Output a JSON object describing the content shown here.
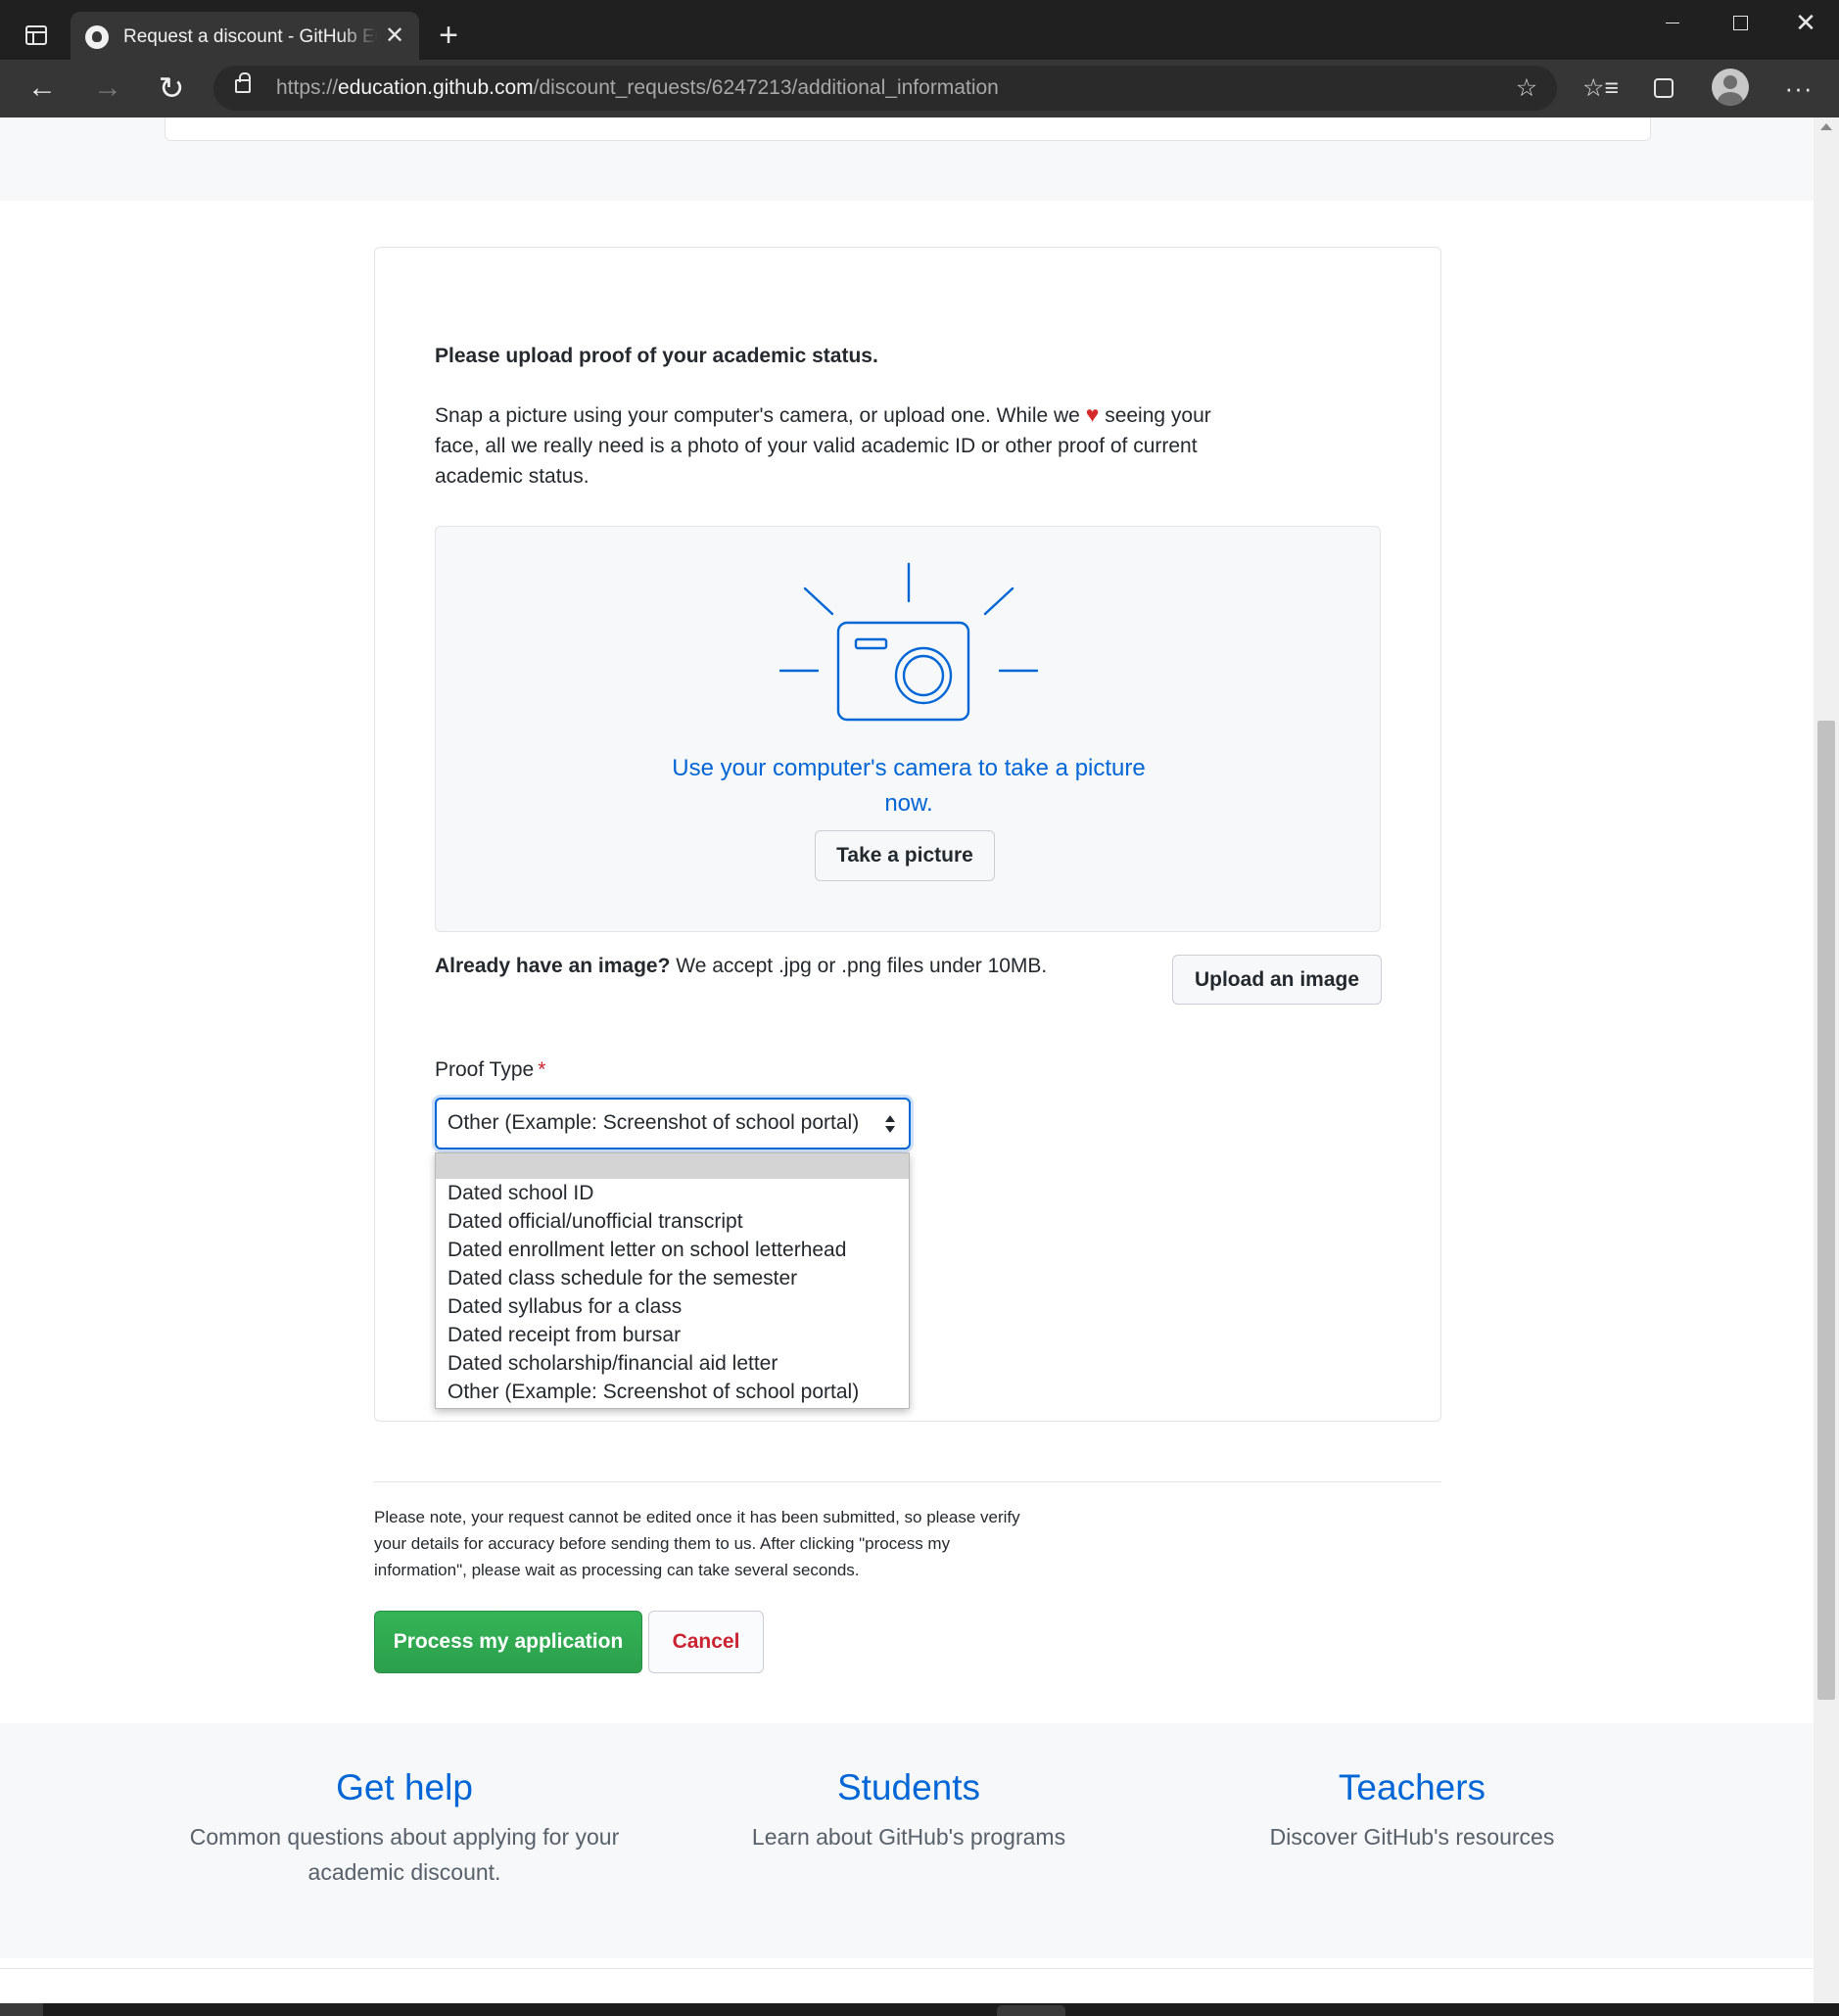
{
  "browser": {
    "tab_title": "Request a discount - GitHub Education",
    "tab_close": "✕",
    "new_tab": "+",
    "url_scheme": "https://",
    "url_host": "education.github.com",
    "url_path": "/discount_requests/6247213/additional_information",
    "window_close": "✕"
  },
  "upload": {
    "heading": "Please upload proof of your academic status.",
    "intro_before_heart": "Snap a picture using your computer's camera, or upload one. While we",
    "heart": "♥",
    "intro_after_heart": "seeing your face, all we really need is a photo of your valid academic ID or other proof of current academic status.",
    "camera_text": "Use your computer's camera to take a picture now.",
    "take_picture_label": "Take a picture",
    "already_bold": "Already have an image?",
    "already_text": "We accept .jpg or .png files under 10MB.",
    "upload_label": "Upload an image"
  },
  "proof_type": {
    "label": "Proof Type",
    "required_mark": "*",
    "selected": "Other (Example: Screenshot of school portal)",
    "options": [
      "Dated school ID",
      "Dated official/unofficial transcript",
      "Dated enrollment letter on school letterhead",
      "Dated class schedule for the semester",
      "Dated syllabus for a class",
      "Dated receipt from bursar",
      "Dated scholarship/financial aid letter",
      "Other (Example: Screenshot of school portal)"
    ]
  },
  "submit": {
    "note": "Please note, your request cannot be edited once it has been submitted, so please verify your details for accuracy before sending them to us. After clicking \"process my information\", please wait as processing can take several seconds.",
    "process_label": "Process my application",
    "cancel_label": "Cancel"
  },
  "footer": {
    "help_title": "Get help",
    "help_desc": "Common questions about applying for your academic discount.",
    "students_title": "Students",
    "students_desc": "Learn about GitHub's programs",
    "teachers_title": "Teachers",
    "teachers_desc": "Discover GitHub's resources"
  },
  "colors": {
    "link_blue": "#0366d6",
    "primary_green": "#2ea44f",
    "danger_red": "#cb2431",
    "heart_red": "#d62a2a",
    "browser_dark": "#202020"
  },
  "icons": {
    "tab_actions": "tab-actions-icon",
    "favicon": "github-icon",
    "back": "arrow-left-icon",
    "forward": "arrow-right-icon",
    "reload": "reload-icon",
    "lock": "lock-icon",
    "add_favorite": "star-plus-icon",
    "favorites": "favorites-icon",
    "collections": "collections-icon",
    "profile": "profile-icon",
    "more": "more-icon",
    "camera": "camera-icon"
  }
}
